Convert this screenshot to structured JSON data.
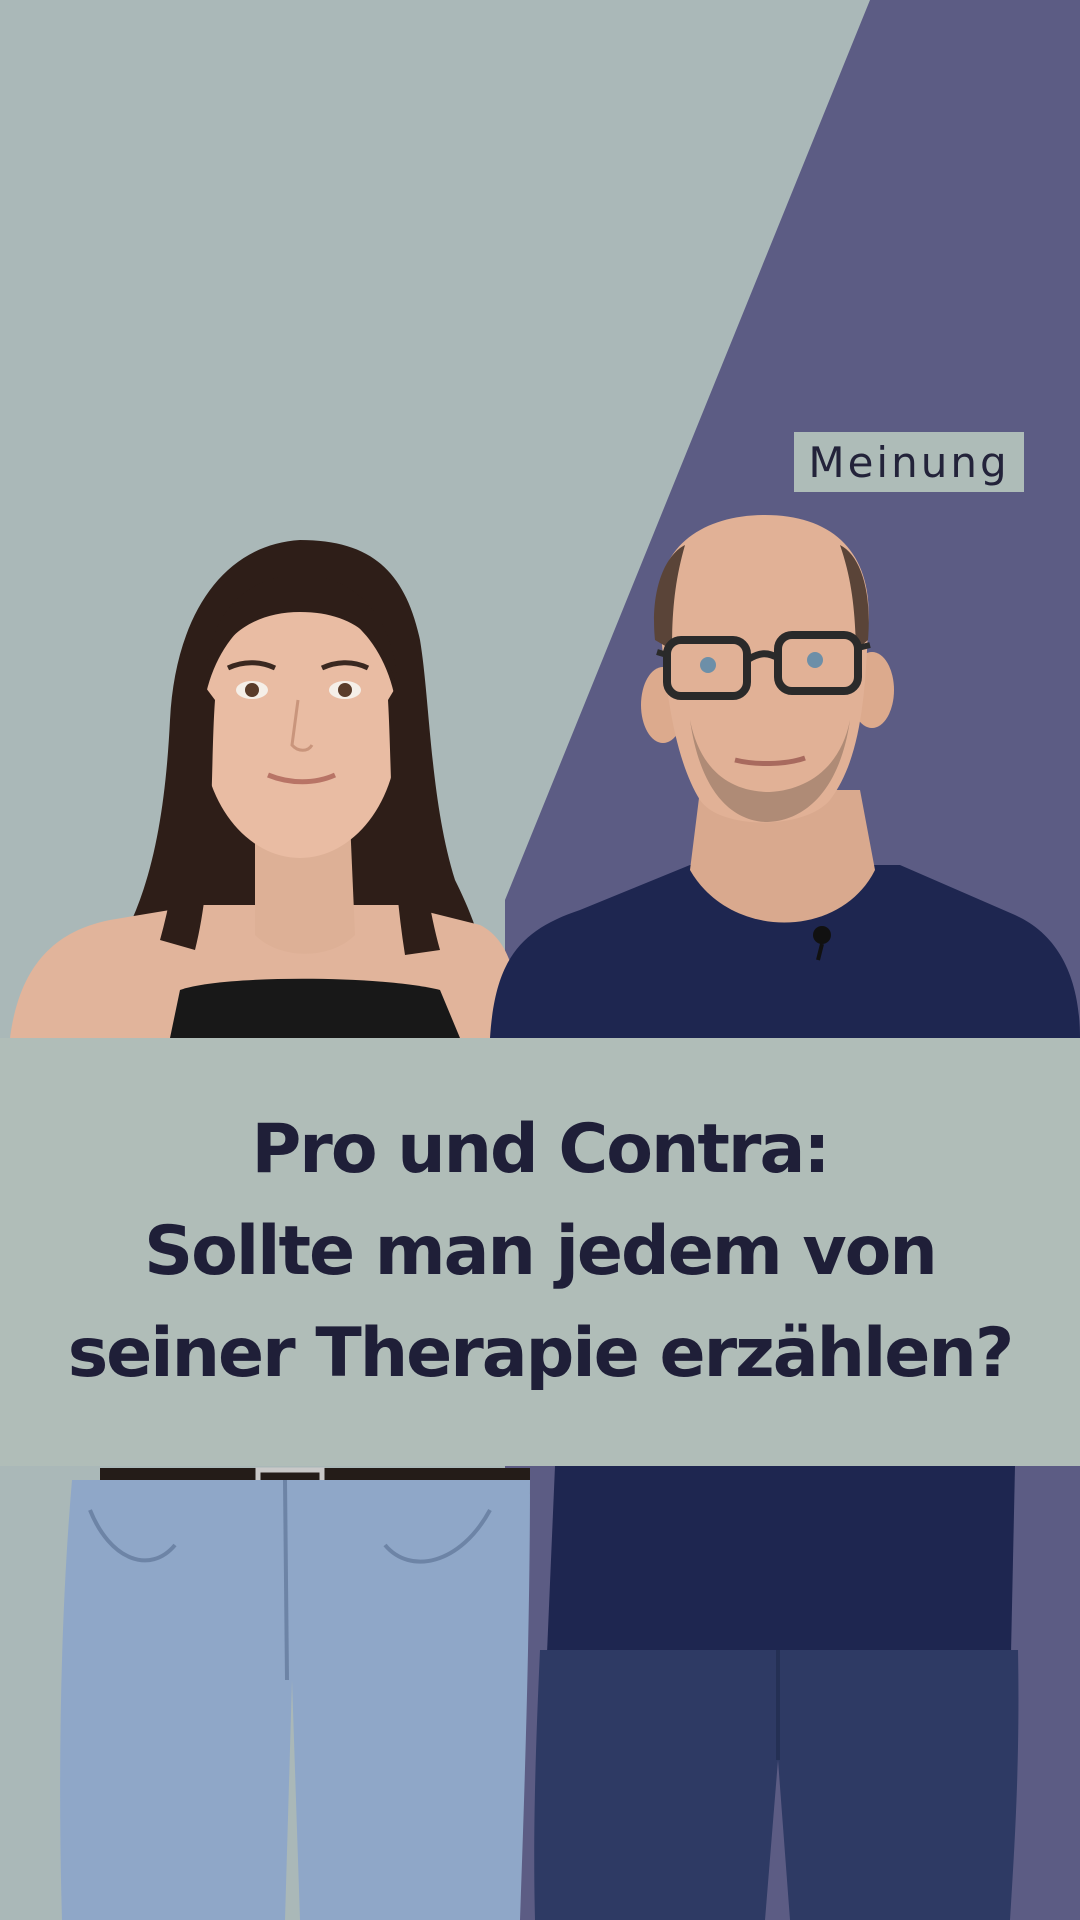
{
  "tag": {
    "label": "Meinung"
  },
  "headline": {
    "line1": "Pro und Contra:",
    "line2": "Sollte man jedem von",
    "line3": "seiner Therapie erzählen?"
  },
  "colors": {
    "background_left": "#aab8b8",
    "background_right": "#5c5c84",
    "banner": "#b0bdb8",
    "headline_text": "#1f1f38"
  }
}
